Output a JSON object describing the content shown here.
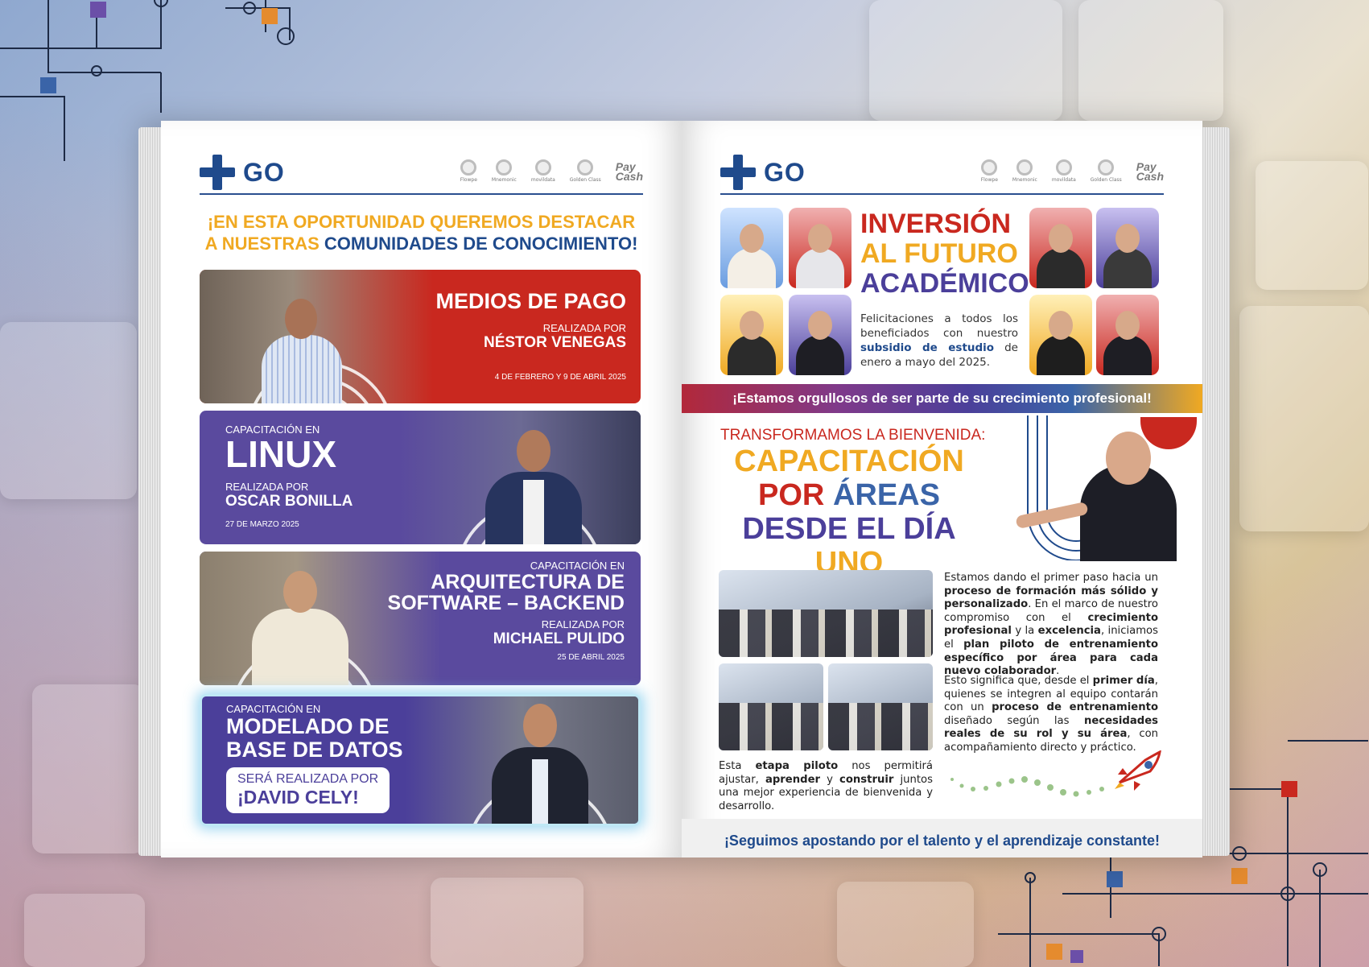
{
  "brand": {
    "logo_text": "GO",
    "partners": [
      "Flowpe",
      "Mnemonic",
      "movildata",
      "Golden Class"
    ],
    "paycash_line1": "Pay",
    "paycash_line2": "Cash"
  },
  "left_page": {
    "intro_line1": "¡EN ESTA OPORTUNIDAD QUEREMOS DESTACAR",
    "intro_line2_a": "A NUESTRAS ",
    "intro_line2_b": "COMUNIDADES DE CONOCIMIENTO!",
    "cards": [
      {
        "title": "MEDIOS DE PAGO",
        "by_label": "REALIZADA POR",
        "presenter": "NÉSTOR VENEGAS",
        "date": "4 DE FEBRERO Y 9 DE ABRIL 2025"
      },
      {
        "kicker": "CAPACITACIÓN EN",
        "title": "LINUX",
        "by_label": "REALIZADA POR",
        "presenter": "OSCAR BONILLA",
        "date": "27 DE MARZO 2025"
      },
      {
        "kicker": "CAPACITACIÓN EN",
        "title_line1": "ARQUITECTURA DE",
        "title_line2": "SOFTWARE – BACKEND",
        "by_label": "REALIZADA POR",
        "presenter": "MICHAEL PULIDO",
        "date": "25 DE ABRIL 2025"
      },
      {
        "kicker": "CAPACITACIÓN EN",
        "title_line1": "MODELADO DE",
        "title_line2": "BASE DE DATOS",
        "by_label": "SERÁ REALIZADA POR",
        "presenter": "¡DAVID CELY!"
      }
    ]
  },
  "right_page": {
    "inv_title_1": "INVERSIÓN",
    "inv_title_2": "AL FUTURO",
    "inv_title_3": "ACADÉMICO",
    "inv_text_a": "Felicitaciones a todos los beneficiados con nuestro ",
    "inv_text_b": "subsidio de estudio",
    "inv_text_c": " de enero a mayo del 2025.",
    "banner": "¡Estamos orgullosos de ser parte de su crecimiento profesional!",
    "trans_kicker": "TRANSFORMAMOS LA BIENVENIDA:",
    "trans_l1": "CAPACITACIÓN",
    "trans_l2a": "POR ",
    "trans_l2b": "ÁREAS",
    "trans_l3a": "DESDE EL DÍA ",
    "trans_l3b": "UNO",
    "p1": [
      "Estamos dando el primer paso hacia un ",
      "proceso de formación más sólido y personalizado",
      ". En el marco de nuestro compromiso con el ",
      "crecimiento profesional",
      " y la ",
      "excelencia",
      ", iniciamos el ",
      "plan piloto de entrenamiento específico por área para cada nuevo colaborador",
      "."
    ],
    "p2": [
      "Esto significa que, desde el ",
      "primer día",
      ", quienes se integren al equipo contarán con un ",
      "proceso de entrenamiento",
      " diseñado según las ",
      "necesidades reales de su rol y su área",
      ", con acompañamiento directo y práctico."
    ],
    "p3": [
      "Esta ",
      "etapa piloto",
      " nos permitirá ajustar, ",
      "aprender",
      " y ",
      "construir",
      " juntos una mejor experiencia de bienvenida y desarrollo."
    ],
    "footer": "¡Seguimos apostando por el talento y el aprendizaje constante!"
  },
  "colors": {
    "brand_blue": "#1f4a8c",
    "yellow": "#f0a922",
    "red": "#c9281f",
    "purple": "#4b3f9a"
  }
}
